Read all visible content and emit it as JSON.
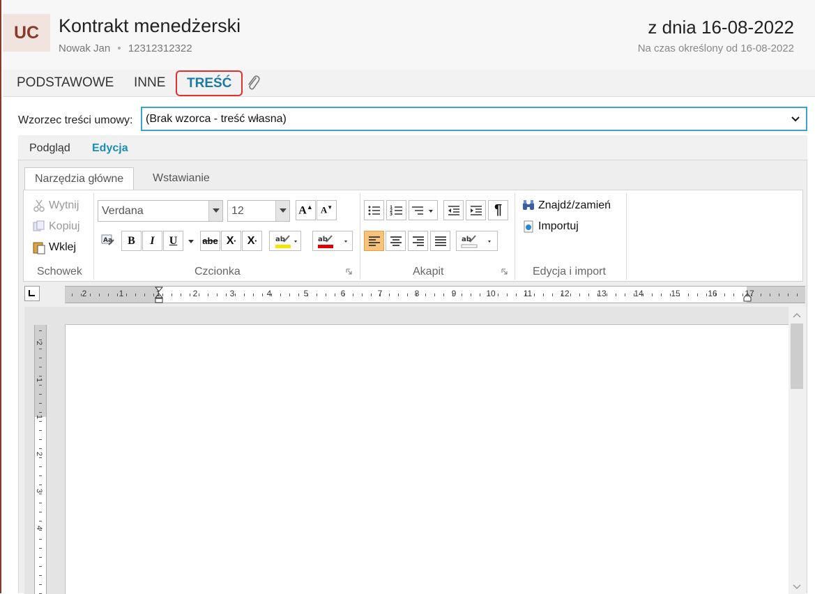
{
  "header": {
    "avatar": "UC",
    "title": "Kontrakt menedżerski",
    "person": "Nowak Jan",
    "separator": "•",
    "id_number": "12312312322",
    "date": "z dnia 16-08-2022",
    "period": "Na czas określony od 16-08-2022"
  },
  "tabs": [
    {
      "label": "PODSTAWOWE"
    },
    {
      "label": "INNE"
    },
    {
      "label": "TREŚĆ",
      "active": true
    }
  ],
  "template": {
    "label": "Wzorzec treści umowy:",
    "value": "(Brak wzorca - treść własna)"
  },
  "subtabs": [
    {
      "label": "Podgląd"
    },
    {
      "label": "Edycja",
      "active": true
    }
  ],
  "ribbon": {
    "tabs": [
      {
        "label": "Narzędzia główne",
        "active": true
      },
      {
        "label": "Wstawianie"
      }
    ],
    "clipboard": {
      "cut": "Wytnij",
      "copy": "Kopiuj",
      "paste": "Wklej",
      "group": "Schowek"
    },
    "font": {
      "family": "Verdana",
      "size": "12",
      "group": "Czcionka",
      "bold": "B",
      "italic": "I",
      "underline": "U",
      "strike": "abe",
      "subscript": "X",
      "superscript": "X"
    },
    "paragraph": {
      "group": "Akapit",
      "pilcrow": "¶"
    },
    "edit": {
      "find": "Znajdź/zamień",
      "import": "Importuj",
      "group": "Edycja i import"
    }
  },
  "ruler": {
    "h_labels": [
      "2",
      "1",
      "1",
      "2",
      "3",
      "4",
      "5",
      "6",
      "7",
      "8",
      "9",
      "10",
      "11",
      "12",
      "13",
      "14",
      "15",
      "16",
      "17"
    ],
    "v_labels": [
      "2",
      "1",
      "1",
      "2",
      "3",
      "4"
    ]
  },
  "colors": {
    "accent": "#1a7aa6",
    "brand": "#8a3a2a",
    "highlight_yellow": "#f5e600",
    "font_red": "#e00000",
    "active_align": "#f7c27a"
  }
}
